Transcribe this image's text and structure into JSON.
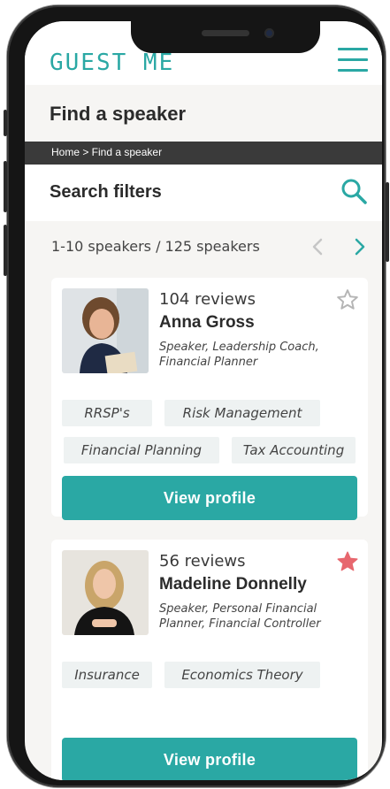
{
  "header": {
    "logo_text": "GUEST ME"
  },
  "page": {
    "title": "Find a speaker"
  },
  "breadcrumb": {
    "text": "Home > Find a speaker"
  },
  "filters": {
    "title": "Search filters"
  },
  "results": {
    "count_text": "1-10 speakers / 125 speakers"
  },
  "speakers": [
    {
      "reviews": "104 reviews",
      "name": "Anna Gross",
      "roles": "Speaker, Leadership Coach, Financial Planner",
      "favorited": false,
      "tags": [
        "RRSP's",
        "Risk Management",
        "Financial Planning",
        "Tax Accounting"
      ],
      "button_label": "View profile"
    },
    {
      "reviews": "56 reviews",
      "name": "Madeline Donnelly",
      "roles": "Speaker, Personal Financial Planner, Financial Controller",
      "favorited": true,
      "tags": [
        "Insurance",
        "Economics Theory"
      ],
      "button_label": "View profile"
    }
  ],
  "icons": {
    "menu": "hamburger-menu-icon",
    "search": "search-icon",
    "prev": "chevron-left-icon",
    "next": "chevron-right-icon",
    "star_empty": "star-outline-icon",
    "star_filled": "star-filled-icon"
  },
  "colors": {
    "accent": "#2aa8a4",
    "breadcrumb_bg": "#3a3a3a",
    "star_filled": "#e7676e",
    "star_empty": "#b5b5b5",
    "disabled_arrow": "#c6c6c6"
  }
}
